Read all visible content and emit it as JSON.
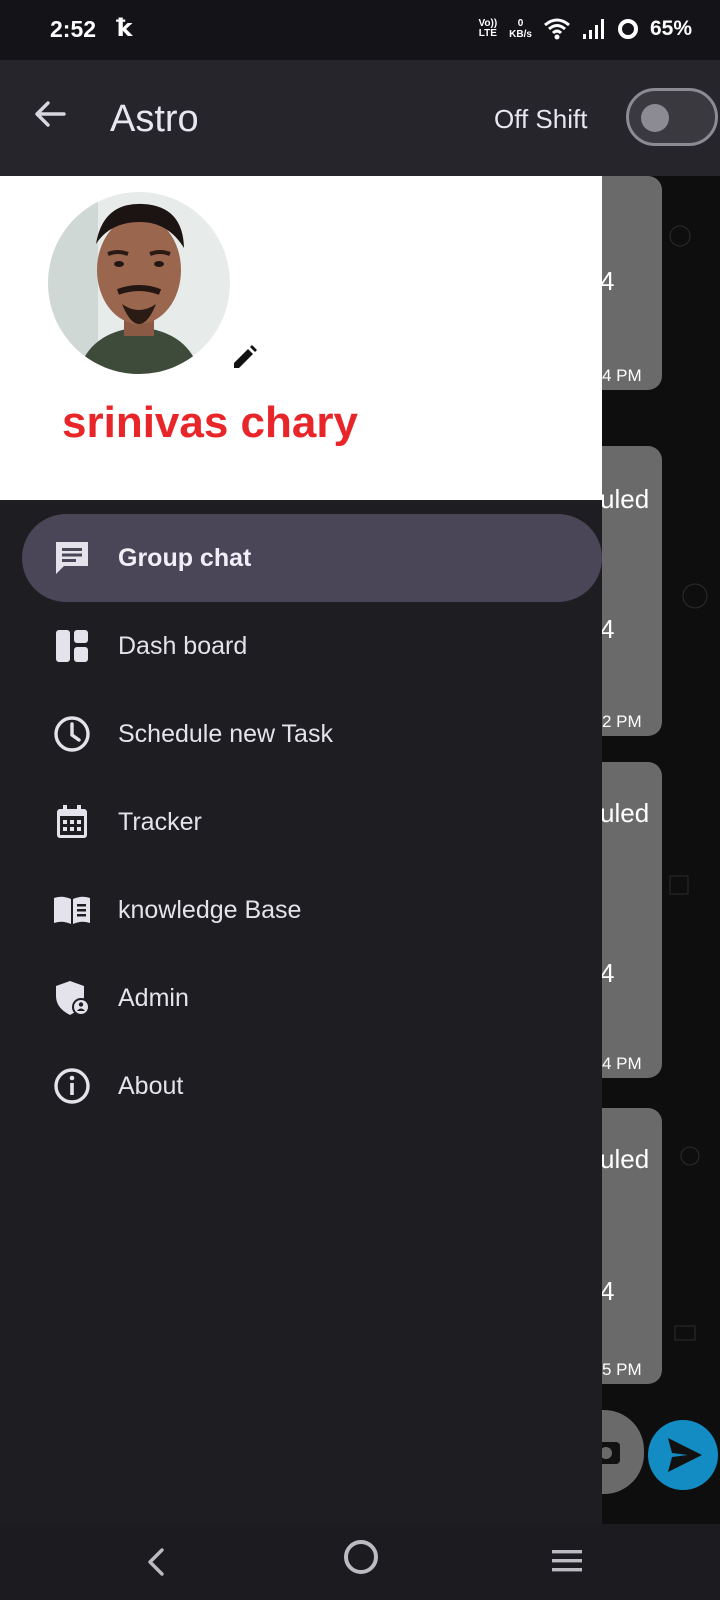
{
  "status_bar": {
    "time": "2:52",
    "carrier_glyph": "ꝁ",
    "volte_top": "Vo))",
    "volte_bottom": "LTE",
    "speed_value": "0",
    "speed_unit": "KB/s",
    "battery": "65%"
  },
  "app_bar": {
    "title": "Astro",
    "shift_label": "Off Shift",
    "shift_on": false
  },
  "profile": {
    "name": "srinivas chary"
  },
  "drawer": {
    "items": [
      {
        "label": "Group chat",
        "icon": "chat-icon",
        "active": true
      },
      {
        "label": "Dash board",
        "icon": "dashboard-icon",
        "active": false
      },
      {
        "label": "Schedule new Task",
        "icon": "clock-icon",
        "active": false
      },
      {
        "label": "Tracker",
        "icon": "calendar-icon",
        "active": false
      },
      {
        "label": "knowledge Base",
        "icon": "book-icon",
        "active": false
      },
      {
        "label": "Admin",
        "icon": "admin-shield-icon",
        "active": false
      },
      {
        "label": "About",
        "icon": "info-icon",
        "active": false
      }
    ]
  },
  "chat_background": {
    "bubbles": [
      {
        "word": "",
        "num": "4",
        "time": "4 PM"
      },
      {
        "word": "uled",
        "num": "4",
        "time": "2 PM"
      },
      {
        "word": "uled",
        "num": "4",
        "time": "4 PM"
      },
      {
        "word": "uled",
        "num": "4",
        "time": "5 PM"
      }
    ]
  },
  "colors": {
    "accent_red": "#e8262a",
    "drawer_bg": "#1e1d22",
    "active_item_bg": "#4a4658",
    "send_button": "#128cc3"
  }
}
